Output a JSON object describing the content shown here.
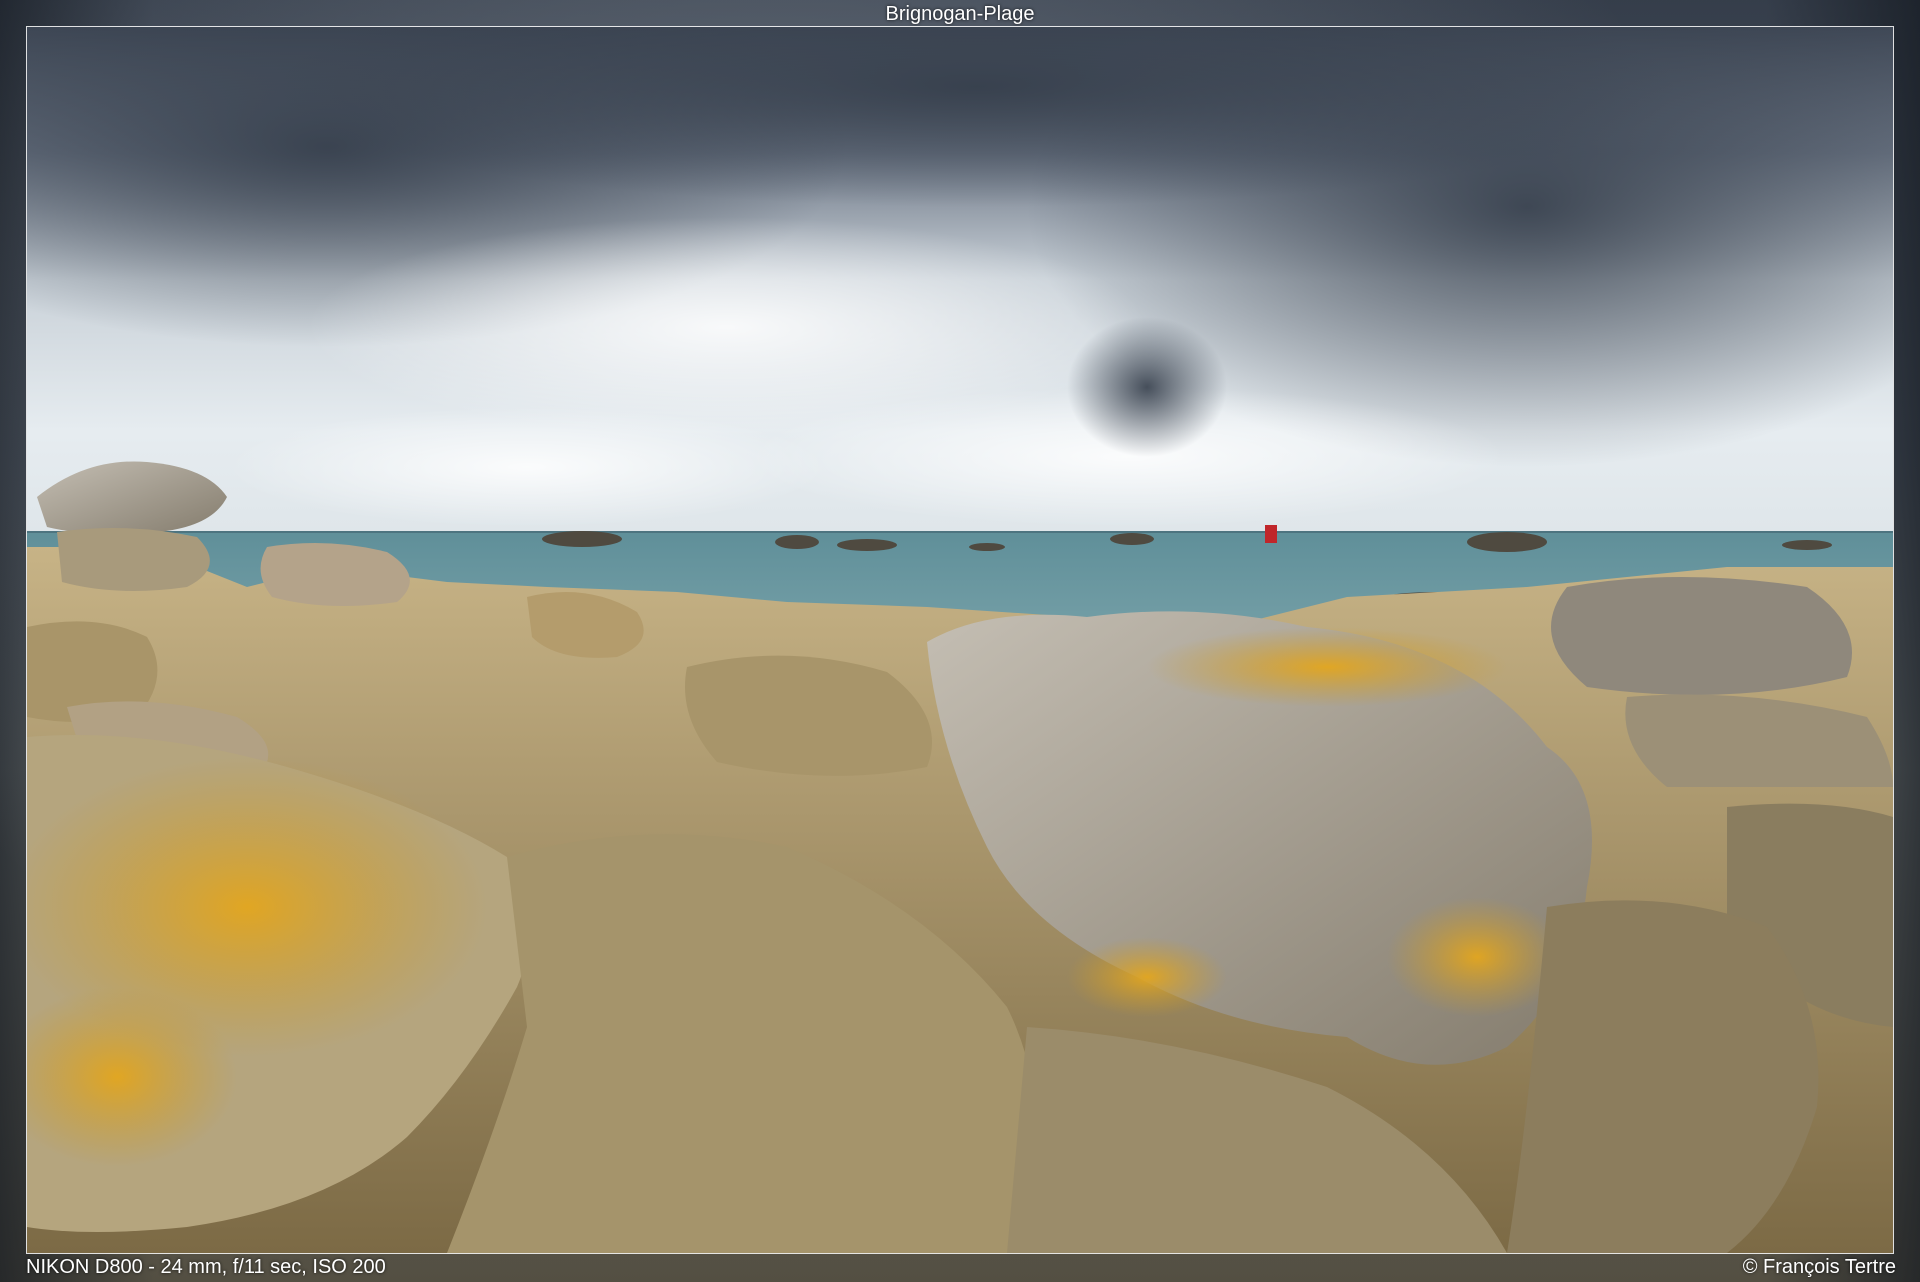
{
  "title": "Brignogan-Plage",
  "exif": "NIKON D800 - 24 mm, f/11 sec, ISO 200",
  "credit": "© François Tertre",
  "colors": {
    "sky_dark": "#4a5462",
    "sky_light": "#e3e9ee",
    "sea": "#6e9aa3",
    "rock_gray": "#a9a39a",
    "rock_tan": "#b8a57a",
    "lichen": "#d9a425"
  }
}
